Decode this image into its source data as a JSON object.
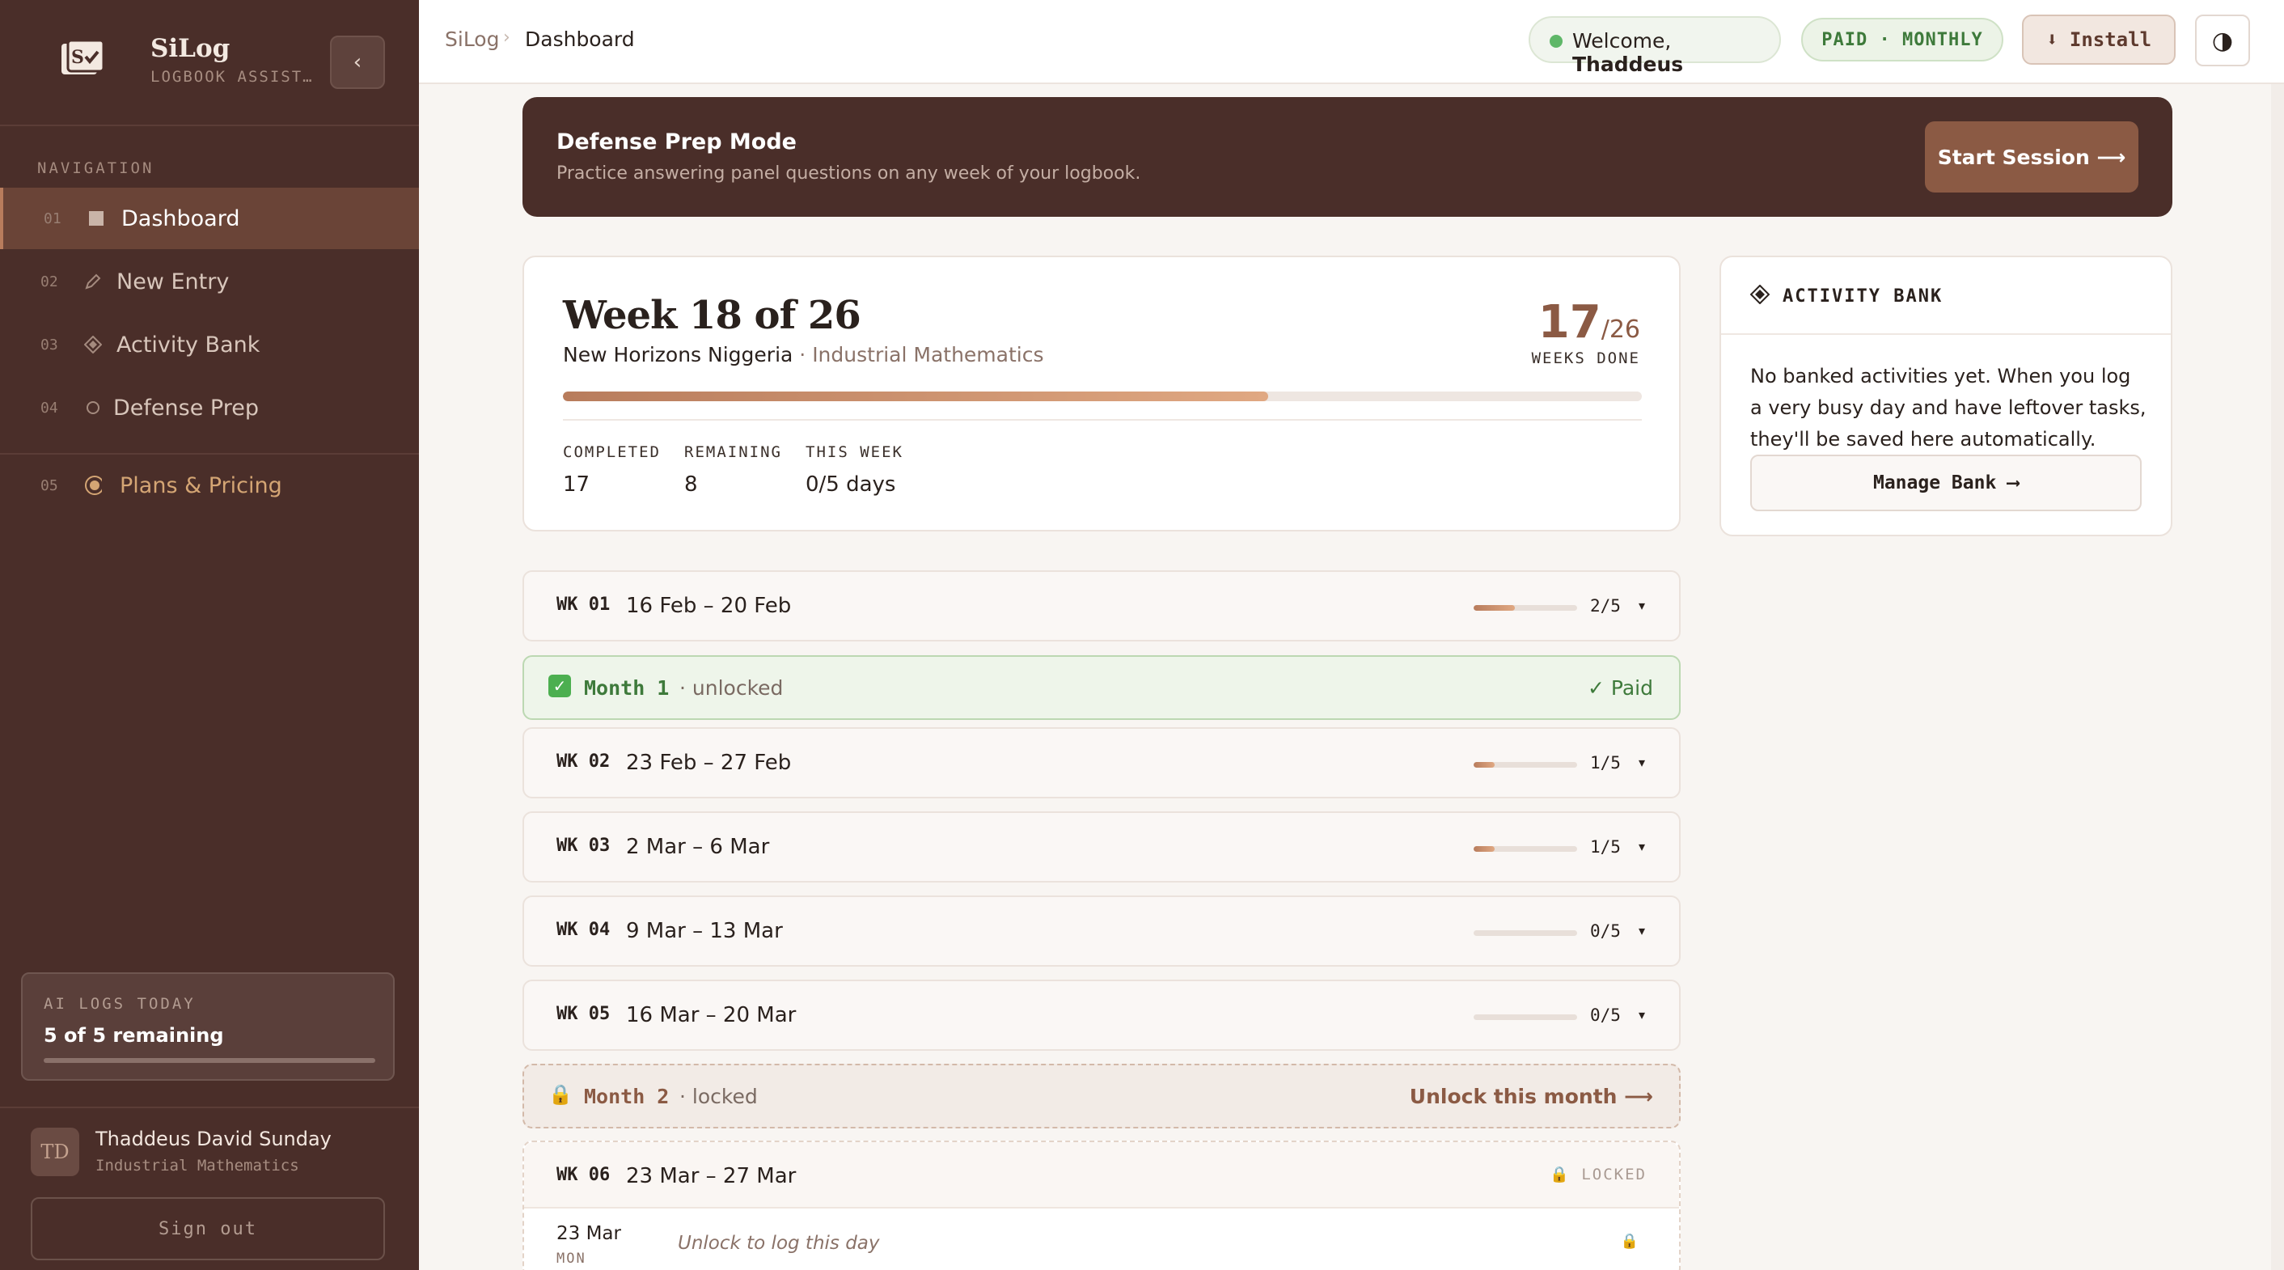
{
  "brand": {
    "name": "SiLog",
    "subtitle": "LOGBOOK ASSISTANT",
    "collapse_glyph": "‹"
  },
  "nav": {
    "heading": "NAVIGATION",
    "items": [
      {
        "num": "01",
        "label": "Dashboard",
        "icon": "square-icon",
        "active": true
      },
      {
        "num": "02",
        "label": "New Entry",
        "icon": "pencil-icon",
        "active": false
      },
      {
        "num": "03",
        "label": "Activity Bank",
        "icon": "diamond-icon",
        "active": false
      },
      {
        "num": "04",
        "label": "Defense Prep",
        "icon": "circle-icon",
        "active": false
      }
    ],
    "pricing": {
      "num": "05",
      "label": "Plans & Pricing",
      "icon": "coin-icon"
    }
  },
  "ai_logs": {
    "title": "AI LOGS TODAY",
    "value": "5 of 5 remaining",
    "used_fraction": 0.0
  },
  "user": {
    "initials": "TD",
    "name": "Thaddeus David Sunday",
    "dept": "Industrial Mathematics",
    "signout": "Sign out"
  },
  "topbar": {
    "crumb_root": "SiLog",
    "crumb_sep": "›",
    "crumb_current": "Dashboard",
    "welcome_prefix": "Welcome, ",
    "welcome_name": "Thaddeus",
    "plan": "PAID · MONTHLY",
    "install": "⬇ Install",
    "theme_glyph": "◑"
  },
  "banner": {
    "title": "Defense Prep Mode",
    "subtitle": "Practice answering panel questions on any week of your logbook.",
    "button": "Start Session ⟶"
  },
  "week_summary": {
    "title": "Week 18 of 26",
    "org": "New Horizons Niggeria",
    "dept_sep": " · ",
    "dept": "Industrial Mathematics",
    "done": "17",
    "total": "/26",
    "done_label": "WEEKS DONE",
    "progress_fraction": 0.654,
    "stats": [
      {
        "label": "COMPLETED",
        "value": "17"
      },
      {
        "label": "REMAINING",
        "value": "8"
      },
      {
        "label": "THIS WEEK",
        "value": "0/5 days"
      }
    ]
  },
  "activity_bank": {
    "title": "ACTIVITY BANK",
    "text": "No banked activities yet. When you log a very busy day and have leftover tasks, they'll be saved here automatically.",
    "button": "Manage Bank ⟶"
  },
  "weeks": [
    {
      "code": "WK 01",
      "dates": "16 Feb – 20 Feb",
      "count": "2/5",
      "fraction": 0.4
    },
    {
      "code": "WK 02",
      "dates": "23 Feb – 27 Feb",
      "count": "1/5",
      "fraction": 0.2
    },
    {
      "code": "WK 03",
      "dates": "2 Mar – 6 Mar",
      "count": "1/5",
      "fraction": 0.2
    },
    {
      "code": "WK 04",
      "dates": "9 Mar – 13 Mar",
      "count": "0/5",
      "fraction": 0.0
    },
    {
      "code": "WK 05",
      "dates": "16 Mar – 20 Mar",
      "count": "0/5",
      "fraction": 0.0
    }
  ],
  "caret": "▾",
  "month1": {
    "label": "Month 1",
    "status": "· unlocked",
    "right": "✓ Paid",
    "icon": "✓"
  },
  "month2": {
    "label": "Month 2",
    "status": "· locked",
    "right": "Unlock this month ⟶",
    "icon": "🔒"
  },
  "locked_week": {
    "code": "WK 06",
    "dates": "23 Mar – 27 Mar",
    "tag": "🔒  LOCKED",
    "day_date": "23 Mar",
    "day_dow": "MON",
    "day_hint": "Unlock to log this day",
    "day_lock": "🔒"
  }
}
